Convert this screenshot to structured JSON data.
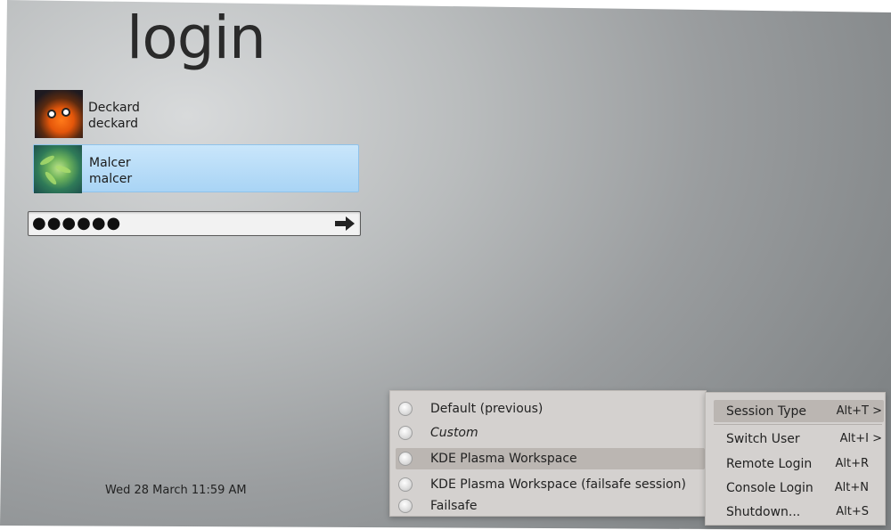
{
  "screen": {
    "title": "login",
    "clock": "Wed 28 March 11:59 AM"
  },
  "users": [
    {
      "name": "Deckard",
      "login": "deckard",
      "selected": false
    },
    {
      "name": "Malcer",
      "login": "malcer",
      "selected": true
    }
  ],
  "password": {
    "masked_value": "●●●●●●",
    "submit_icon": "arrow-right-icon"
  },
  "session_menu": {
    "items": [
      {
        "label": "Default (previous)",
        "style": "normal"
      },
      {
        "label": "Custom",
        "style": "italic"
      },
      {
        "label": "KDE Plasma Workspace",
        "style": "normal",
        "highlighted": true
      },
      {
        "label": "KDE Plasma Workspace (failsafe session)",
        "style": "normal"
      },
      {
        "label": "Failsafe",
        "style": "normal"
      }
    ]
  },
  "main_menu": {
    "items": [
      {
        "label": "Session Type",
        "shortcut": "Alt+T",
        "submenu": true,
        "highlighted": true
      },
      {
        "label": "Switch User",
        "shortcut": "Alt+I",
        "submenu": true
      },
      {
        "label": "Remote Login",
        "shortcut": "Alt+R"
      },
      {
        "label": "Console Login",
        "shortcut": "Alt+N"
      },
      {
        "label": "Shutdown...",
        "shortcut": "Alt+S"
      }
    ],
    "submenu_arrow": ">"
  },
  "colors": {
    "selection": "#a9d4f5",
    "menu_bg": "#d4d1cf",
    "menu_highlight": "#bbb6b2"
  }
}
